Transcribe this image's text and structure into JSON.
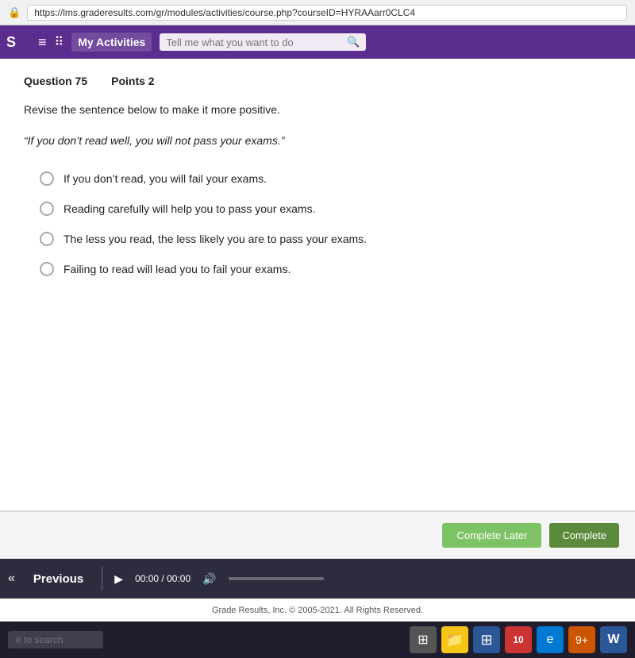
{
  "browser": {
    "url": "https://lms.graderesults.com/gr/modules/activities/course.php?courseID=HYRAAarr0CLC4"
  },
  "nav": {
    "s_label": "S",
    "my_activities": "My Activities",
    "search_placeholder": "Tell me what you want to do"
  },
  "question": {
    "number_label": "Question 75",
    "points_label": "Points 2",
    "instruction": "Revise the sentence below to make it more positive.",
    "quote": "“If you don’t read well, you will not pass your exams.”",
    "options": [
      "If you don’t read, you will fail your exams.",
      "Reading carefully will help you to pass your exams.",
      "The less you read, the less likely you are to pass your exams.",
      "Failing to read will lead you to fail your exams."
    ]
  },
  "buttons": {
    "complete_later": "Complete Later",
    "complete": "Complete"
  },
  "footer": {
    "previous_label": "Previous",
    "time": "00:00 / 00:00"
  },
  "copyright": "Grade Results, Inc. © 2005-2021. All Rights Reserved.",
  "taskbar": {
    "search_placeholder": "e to search"
  }
}
